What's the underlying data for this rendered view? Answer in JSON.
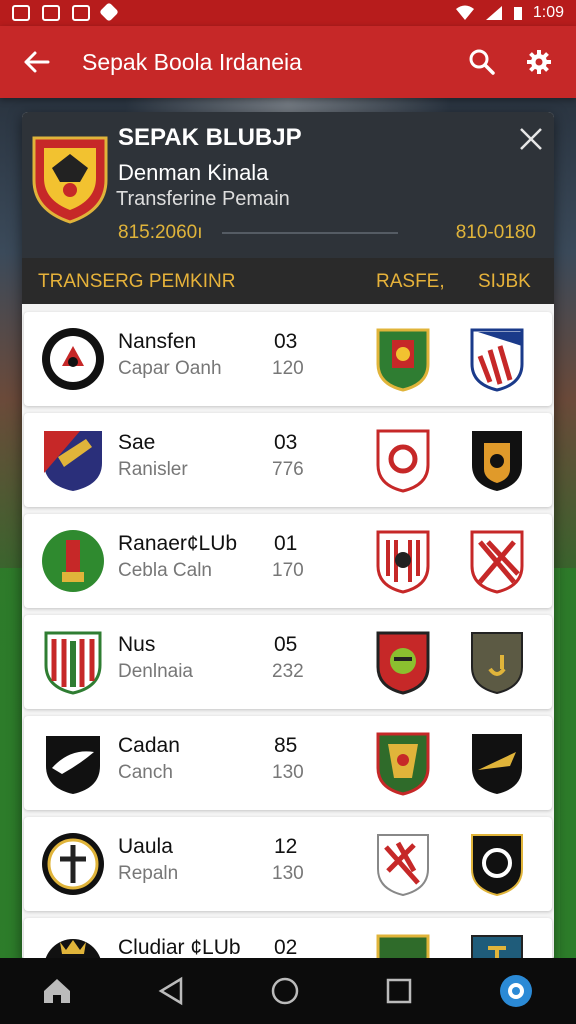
{
  "status": {
    "time": "1:09"
  },
  "appbar": {
    "title": "Sepak Boola Irdaneia"
  },
  "card": {
    "title": "SEPAK BLUBJP",
    "subtitle": "Denman Kinala",
    "subtitle2": "Transferine Pemain",
    "value_left": "815:2060ı",
    "value_right": "810-0180",
    "columns": {
      "player": "TRANSERG PEMKINR",
      "from": "RASFE,",
      "to": "SIJBK"
    }
  },
  "rows": [
    {
      "name": "Nansfen",
      "sub": "Capar Oanh",
      "num": "03",
      "num2": "120"
    },
    {
      "name": "Sae",
      "sub": "Ranisler",
      "num": "03",
      "num2": "776"
    },
    {
      "name": "Ranaer¢LUb",
      "sub": "Cebla Caln",
      "num": "01",
      "num2": "170"
    },
    {
      "name": "Nus",
      "sub": "Denlnaia",
      "num": "05",
      "num2": "232"
    },
    {
      "name": "Cadan",
      "sub": "Canch",
      "num": "85",
      "num2": "130"
    },
    {
      "name": "Uaula",
      "sub": "Repaln",
      "num": "12",
      "num2": "130"
    },
    {
      "name": "Cludiar ¢LUb",
      "sub": "",
      "num": "02",
      "num2": ""
    }
  ],
  "colors": {
    "primary": "#c62828",
    "dark_header": "#2e3339",
    "accent_gold": "#e0b43a"
  }
}
